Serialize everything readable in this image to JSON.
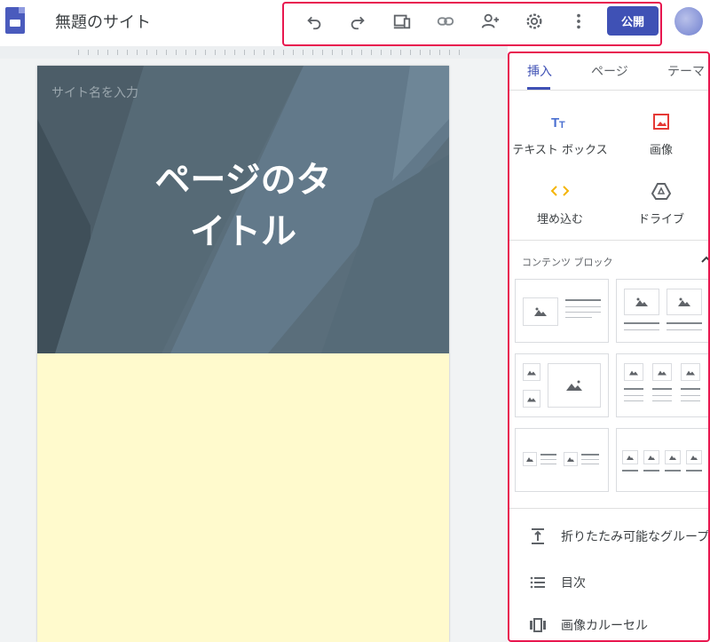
{
  "app": {
    "site_title": "無題のサイト",
    "publish_label": "公開"
  },
  "toolbar": {
    "icons": [
      "undo-icon",
      "redo-icon",
      "preview-icon",
      "link-icon",
      "share-icon",
      "settings-icon",
      "more-icon"
    ]
  },
  "page": {
    "site_name_placeholder": "サイト名を入力",
    "title_line1": "ページのタ",
    "title_line2": "イトル"
  },
  "panel": {
    "tabs": [
      "挿入",
      "ページ",
      "テーマ"
    ],
    "insert_items": [
      {
        "label": "テキスト ボックス",
        "icon": "text-box-icon"
      },
      {
        "label": "画像",
        "icon": "image-icon"
      },
      {
        "label": "埋め込む",
        "icon": "embed-icon"
      },
      {
        "label": "ドライブ",
        "icon": "drive-icon"
      }
    ],
    "content_blocks_label": "コンテンツ ブロック",
    "list_items": [
      {
        "label": "折りたたみ可能なグループ",
        "icon": "collapsible-group-icon"
      },
      {
        "label": "目次",
        "icon": "table-of-contents-icon"
      },
      {
        "label": "画像カルーセル",
        "icon": "image-carousel-icon"
      }
    ]
  },
  "colors": {
    "accent": "#3f51b5",
    "highlight_border": "#e8174f",
    "hero_bg": "#5a6e7b",
    "page_bg": "#fffacd"
  }
}
